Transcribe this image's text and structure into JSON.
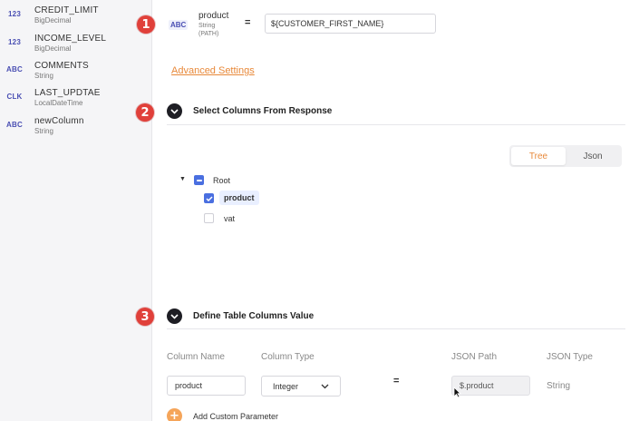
{
  "sidebar": {
    "fields": [
      {
        "badge": "123",
        "name": "CREDIT_LIMIT",
        "type": "BigDecimal"
      },
      {
        "badge": "123",
        "name": "INCOME_LEVEL",
        "type": "BigDecimal"
      },
      {
        "badge": "ABC",
        "name": "COMMENTS",
        "type": "String"
      },
      {
        "badge": "CLK",
        "name": "LAST_UPDTAE",
        "type": "LocalDateTime"
      },
      {
        "badge": "ABC",
        "name": "newColumn",
        "type": "String"
      }
    ]
  },
  "steps": [
    "1",
    "2",
    "3"
  ],
  "param": {
    "badge": "ABC",
    "name": "product",
    "type_line1": "String",
    "type_line2": "(PATH)",
    "equals": "=",
    "value": "${CUSTOMER_FIRST_NAME}"
  },
  "advanced_settings_label": "Advanced Settings",
  "section_response": {
    "title": "Select Columns From Response",
    "view_toggle": {
      "tree": "Tree",
      "json": "Json",
      "selected": "Tree"
    },
    "tree": {
      "root": {
        "label": "Root",
        "state": "indeterminate",
        "expanded": true
      },
      "children": [
        {
          "label": "product",
          "checked": true
        },
        {
          "label": "vat",
          "checked": false
        }
      ]
    }
  },
  "section_table": {
    "title": "Define Table Columns Value",
    "headers": {
      "column_name": "Column Name",
      "column_type": "Column Type",
      "json_path": "JSON Path",
      "json_type": "JSON Type"
    },
    "row": {
      "column_name": "product",
      "column_type": "Integer",
      "equals": "=",
      "json_path": "$.product",
      "json_type": "String"
    },
    "add_custom_parameter": "Add Custom Parameter"
  },
  "colors": {
    "accent_orange": "#e8893a",
    "step_red": "#e0403a",
    "badge_blue": "#4a4fb3",
    "checkbox_blue": "#4a6fe0"
  }
}
